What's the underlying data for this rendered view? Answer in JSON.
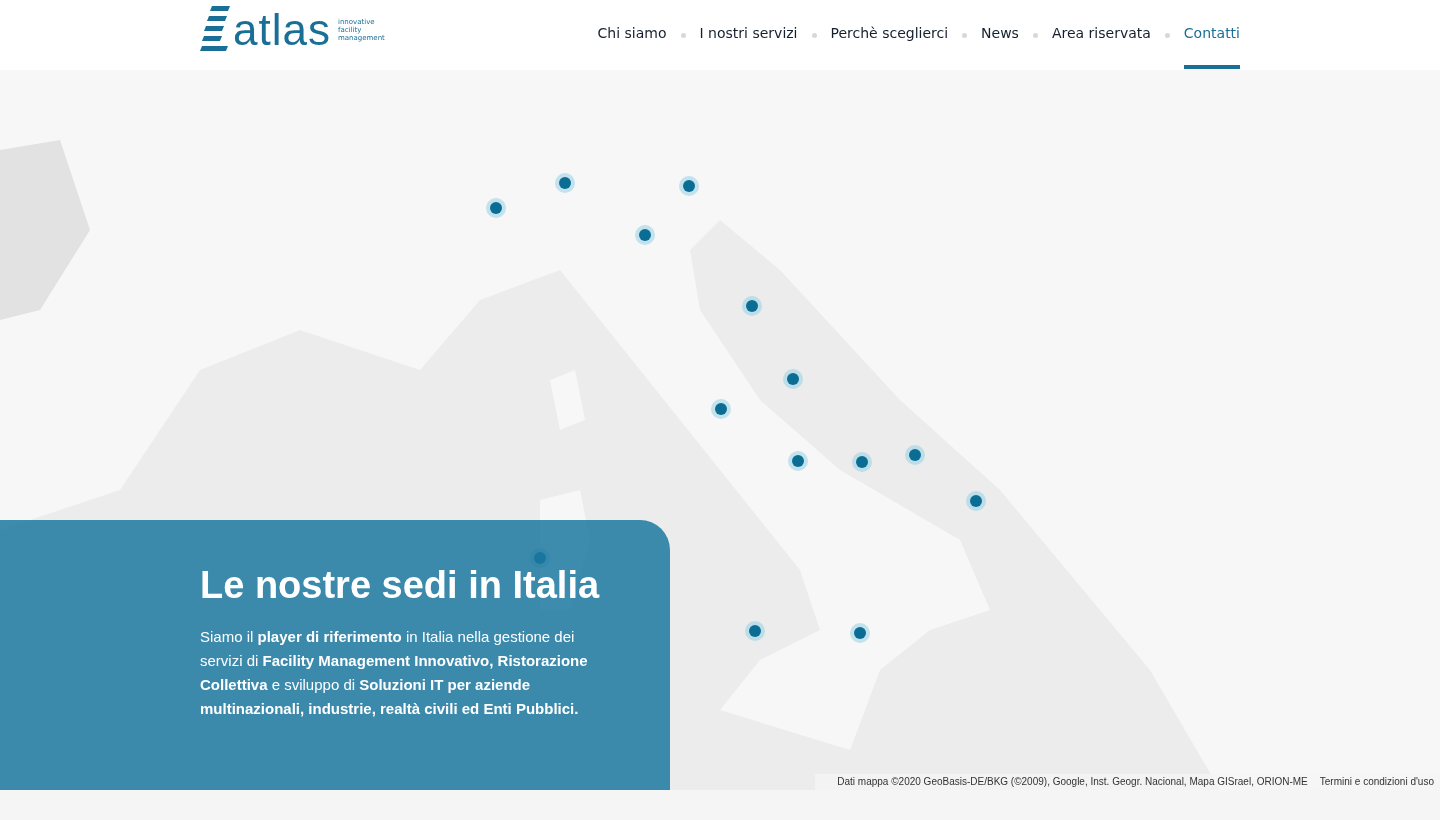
{
  "header": {
    "logo": {
      "wordmark": "atlas",
      "tagline": "innovative facility management"
    },
    "nav": [
      {
        "label": "Chi siamo",
        "selected": false
      },
      {
        "label": "I nostri servizi",
        "selected": false
      },
      {
        "label": "Perchè sceglierci",
        "selected": false
      },
      {
        "label": "News",
        "selected": false
      },
      {
        "label": "Area riservata",
        "selected": false
      },
      {
        "label": "Contatti",
        "selected": true
      }
    ]
  },
  "hero": {
    "title": "Le nostre sedi in Italia",
    "text": "Siamo il **player di riferimento** in Italia nella gestione dei servizi di **Facility Management Innovativo, Ristorazione Collettiva** e sviluppo di **Soluzioni IT per aziende multinazionali, industrie, realtà civili ed Enti Pubblici.**"
  },
  "map": {
    "attribution": "Dati mappa ©2020 GeoBasis-DE/BKG (©2009), Google, Inst. Geogr. Nacional, Mapa GISrael, ORION-ME",
    "terms_link": "Termini e condizioni d'uso"
  }
}
